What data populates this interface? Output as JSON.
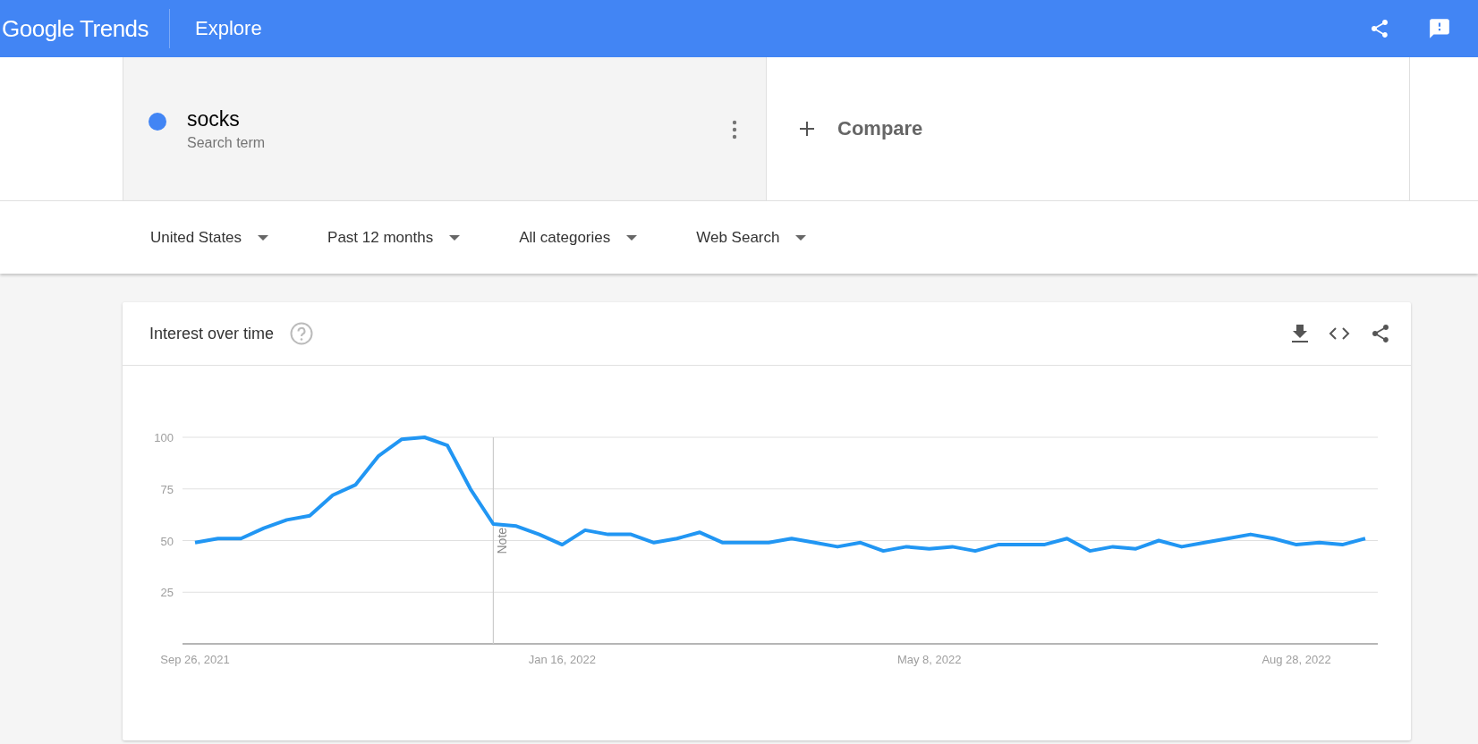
{
  "header": {
    "logo": "Google Trends",
    "title": "Explore"
  },
  "search_terms": [
    {
      "term": "socks",
      "type": "Search term",
      "color": "#4285f4"
    }
  ],
  "compare": {
    "label": "Compare"
  },
  "filters": [
    {
      "label": "United States"
    },
    {
      "label": "Past 12 months"
    },
    {
      "label": "All categories"
    },
    {
      "label": "Web Search"
    }
  ],
  "interest_card": {
    "title": "Interest over time",
    "chart_data": {
      "type": "line",
      "grid": true,
      "ylim": [
        0,
        100
      ],
      "yticks": [
        25,
        50,
        75,
        100
      ],
      "categories": [
        "Sep 26, 2021",
        null,
        null,
        null,
        null,
        null,
        null,
        null,
        null,
        null,
        null,
        null,
        null,
        null,
        null,
        null,
        "Jan 16, 2022",
        null,
        null,
        null,
        null,
        null,
        null,
        null,
        null,
        null,
        null,
        null,
        null,
        null,
        null,
        null,
        "May 8, 2022",
        null,
        null,
        null,
        null,
        null,
        null,
        null,
        null,
        null,
        null,
        null,
        null,
        null,
        null,
        null,
        "Aug 28, 2022",
        null,
        null,
        null
      ],
      "series": [
        {
          "color": "#2196f3",
          "values": [
            49,
            51,
            51,
            56,
            60,
            62,
            72,
            77,
            91,
            99,
            100,
            96,
            75,
            58,
            57,
            53,
            48,
            55,
            53,
            53,
            49,
            51,
            54,
            49,
            49,
            49,
            51,
            49,
            47,
            49,
            45,
            47,
            46,
            47,
            45,
            48,
            48,
            48,
            51,
            45,
            47,
            46,
            50,
            47,
            49,
            51,
            53,
            51,
            48,
            49,
            48,
            51
          ]
        }
      ],
      "annotations": [
        "Note"
      ]
    }
  }
}
